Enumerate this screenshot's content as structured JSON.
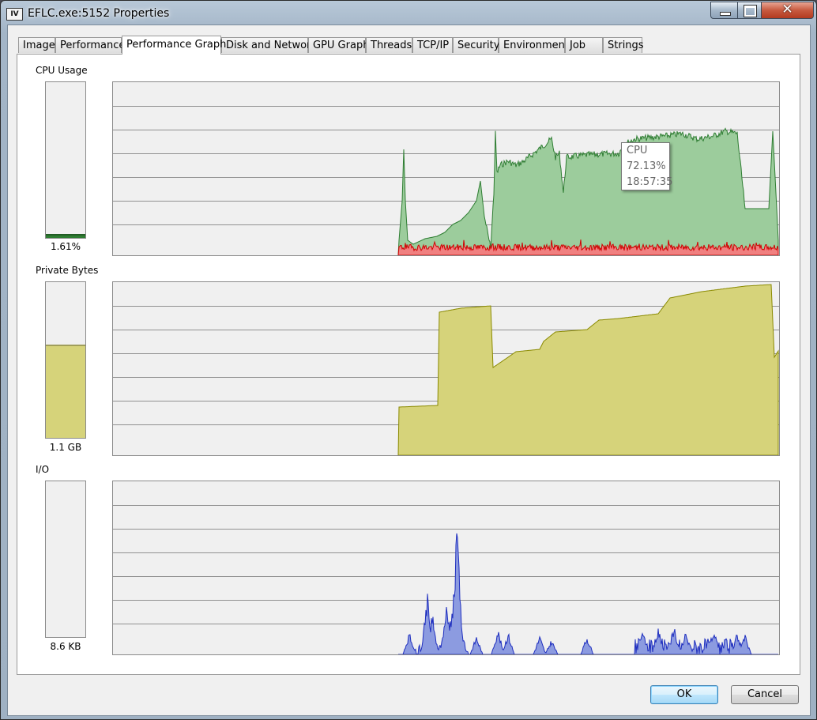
{
  "window": {
    "title": "EFLC.exe:5152 Properties",
    "app_icon_text": "IV",
    "close_glyph": "✕"
  },
  "tabs": [
    {
      "label": "Image"
    },
    {
      "label": "Performance"
    },
    {
      "label": "Performance Graph",
      "active": true
    },
    {
      "label": "Disk and Network"
    },
    {
      "label": "GPU Graph"
    },
    {
      "label": "Threads"
    },
    {
      "label": "TCP/IP"
    },
    {
      "label": "Security"
    },
    {
      "label": "Environment"
    },
    {
      "label": "Job"
    },
    {
      "label": "Strings"
    }
  ],
  "cpu": {
    "label": "CPU Usage",
    "meter_value": "1.61%",
    "meter_fraction": 0.0161,
    "color_total": "#2e7d32",
    "fill_total": "#9ccc9c",
    "color_kernel": "#d00000",
    "fill_kernel": "#f08080",
    "tooltip": {
      "title": "CPU",
      "value": "72.13%",
      "time": "18:57:35"
    }
  },
  "private_bytes": {
    "label": "Private Bytes",
    "meter_value": "1.1 GB",
    "meter_fraction": 0.59,
    "color_line": "#8a8a00",
    "color_fill": "#d6d37a"
  },
  "io": {
    "label": "I/O",
    "meter_value": "8.6  KB",
    "meter_fraction": 0.0,
    "color_line": "#1f2fbf",
    "color_fill": "#8c9be0"
  },
  "buttons": {
    "ok": "OK",
    "cancel": "Cancel"
  }
}
